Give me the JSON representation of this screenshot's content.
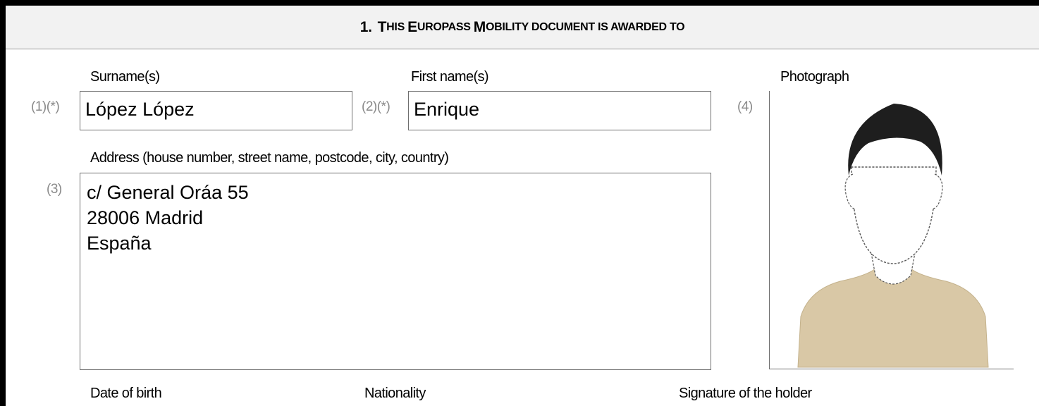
{
  "section": {
    "number": "1.",
    "title_parts": [
      {
        "text": "T",
        "size": "big"
      },
      {
        "text": "HIS ",
        "size": "small"
      },
      {
        "text": "E",
        "size": "big"
      },
      {
        "text": "UROPASS ",
        "size": "small"
      },
      {
        "text": "M",
        "size": "big"
      },
      {
        "text": "OBILITY DOCUMENT IS AWARDED TO",
        "size": "small"
      }
    ]
  },
  "holder": {
    "surname": {
      "label": "Surname(s)",
      "number": "(1)(*)",
      "value": "López López"
    },
    "first_name": {
      "label": "First name(s)",
      "number": "(2)(*)",
      "value": "Enrique"
    },
    "address": {
      "label": "Address (house number, street name, postcode, city, country)",
      "number": "(3)",
      "lines": [
        "c/ General Oráa 55",
        "28006 Madrid",
        "España"
      ]
    },
    "photograph": {
      "label": "Photograph",
      "number": "(4)"
    },
    "date_of_birth": {
      "label": "Date of birth"
    },
    "nationality": {
      "label": "Nationality"
    },
    "signature": {
      "label": "Signature of the holder"
    }
  },
  "colors": {
    "header_bg": "#f2f2f2",
    "border_dark": "#000000",
    "field_border": "#6f6f6f",
    "number_gray": "#8a8a8a",
    "hair": "#1e1e1e",
    "shirt": "#d9c8a6"
  },
  "icons": [
    "photograph-silhouette"
  ]
}
